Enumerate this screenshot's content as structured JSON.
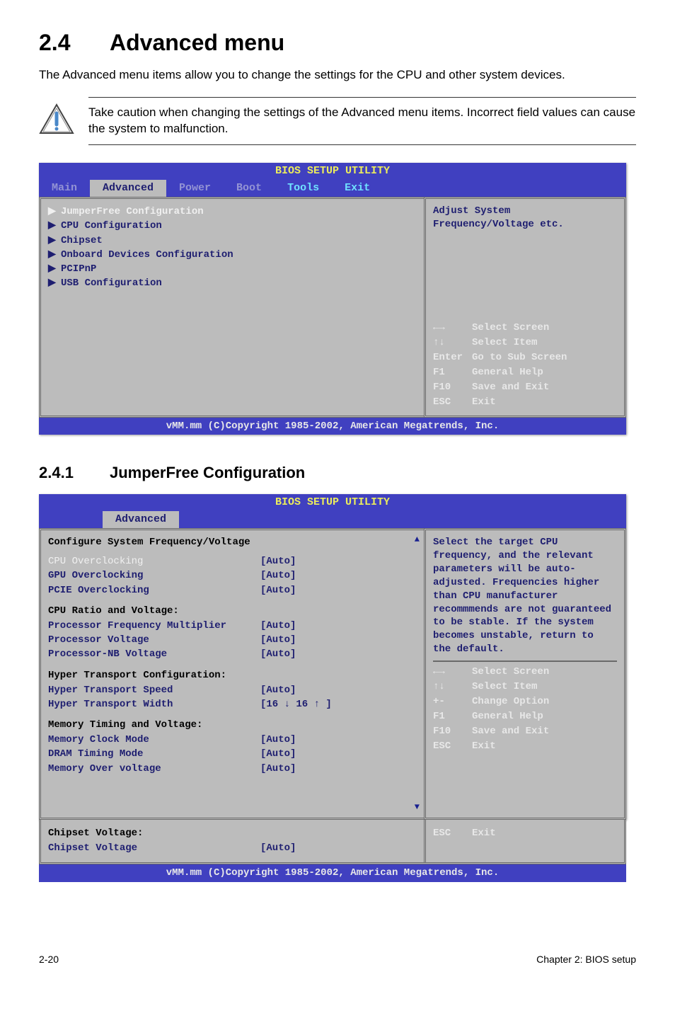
{
  "section": {
    "number": "2.4",
    "title": "Advanced menu"
  },
  "intro": "The Advanced menu items allow you to change the settings for the CPU and other system devices.",
  "note": "Take caution when changing the settings of the Advanced menu items. Incorrect field values can cause the system to malfunction.",
  "bios1": {
    "title": "BIOS SETUP UTILITY",
    "tabs": [
      "Main",
      "Advanced",
      "Power",
      "Boot",
      "Tools",
      "Exit"
    ],
    "active_tab": "Advanced",
    "items": [
      "JumperFree Configuration",
      "CPU Configuration",
      "Chipset",
      "Onboard Devices Configuration",
      "PCIPnP",
      "USB Configuration"
    ],
    "help": "Adjust System Frequency/Voltage etc.",
    "keys": [
      {
        "k": "←→",
        "d": "Select Screen"
      },
      {
        "k": "↑↓",
        "d": "Select Item"
      },
      {
        "k": "Enter",
        "d": "Go to Sub Screen"
      },
      {
        "k": "F1",
        "d": "General Help"
      },
      {
        "k": "F10",
        "d": "Save and Exit"
      },
      {
        "k": "ESC",
        "d": "Exit"
      }
    ],
    "footer": "vMM.mm (C)Copyright 1985-2002, American Megatrends, Inc."
  },
  "subsection": {
    "number": "2.4.1",
    "title": "JumperFree Configuration"
  },
  "bios2": {
    "title": "BIOS SETUP UTILITY",
    "tab": "Advanced",
    "header": "Configure System Frequency/Voltage",
    "groups": [
      {
        "rows": [
          {
            "lbl": "CPU Overclocking",
            "val": "[Auto]",
            "sel": true
          },
          {
            "lbl": "GPU Overclocking",
            "val": "[Auto]"
          },
          {
            "lbl": "PCIE Overclocking",
            "val": "[Auto]"
          }
        ]
      },
      {
        "title": "CPU Ratio and Voltage:",
        "rows": [
          {
            "lbl": "Processor Frequency Multiplier",
            "val": "[Auto]"
          },
          {
            "lbl": "Processor Voltage",
            "val": "[Auto]"
          },
          {
            "lbl": "Processor-NB Voltage",
            "val": "[Auto]"
          }
        ]
      },
      {
        "title": "Hyper Transport Configuration:",
        "rows": [
          {
            "lbl": "Hyper Transport Speed",
            "val": "[Auto]"
          },
          {
            "lbl": "Hyper Transport Width",
            "val": "[16 ↓ 16 ↑ ]"
          }
        ]
      },
      {
        "title": "Memory Timing and Voltage:",
        "rows": [
          {
            "lbl": "Memory Clock Mode",
            "val": "[Auto]"
          },
          {
            "lbl": "DRAM Timing Mode",
            "val": "[Auto]"
          },
          {
            "lbl": "Memory Over voltage",
            "val": "[Auto]"
          }
        ]
      }
    ],
    "help": "Select the target CPU frequency, and the relevant parameters will be auto-adjusted. Frequencies higher than CPU manufacturer recommmends are not guaranteed to be stable. If the system becomes unstable, return to the default.",
    "keys": [
      {
        "k": "←→",
        "d": "Select Screen"
      },
      {
        "k": "↑↓",
        "d": "Select Item"
      },
      {
        "k": "+-",
        "d": "Change Option"
      },
      {
        "k": "F1",
        "d": "General Help"
      },
      {
        "k": "F10",
        "d": "Save and Exit"
      },
      {
        "k": "ESC",
        "d": "Exit"
      }
    ],
    "overflow": {
      "title": "Chipset Voltage:",
      "rows": [
        {
          "lbl": "Chipset Voltage",
          "val": "[Auto]"
        }
      ],
      "esc_k": "ESC",
      "esc_d": "Exit"
    },
    "footer": "vMM.mm (C)Copyright 1985-2002, American Megatrends, Inc."
  },
  "page_footer": {
    "left": "2-20",
    "right": "Chapter 2: BIOS setup"
  }
}
